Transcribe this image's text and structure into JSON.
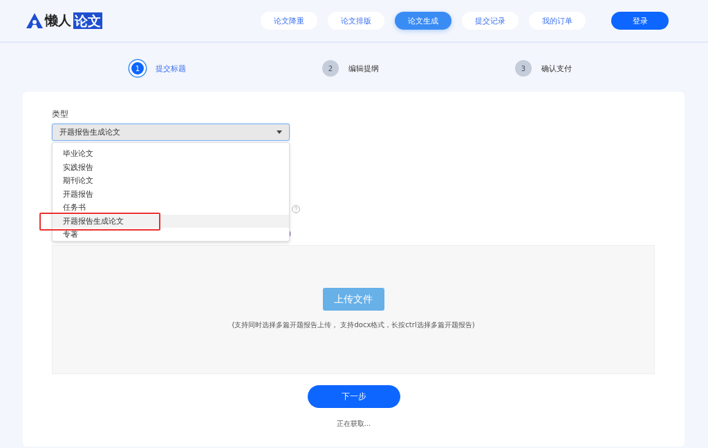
{
  "header": {
    "logo": {
      "text": "懒人",
      "badge": "论文"
    },
    "nav": [
      {
        "label": "论文降重",
        "selected": false
      },
      {
        "label": "论文排版",
        "selected": false
      },
      {
        "label": "论文生成",
        "selected": true
      },
      {
        "label": "提交记录",
        "selected": false
      },
      {
        "label": "我的订单",
        "selected": false
      }
    ],
    "login": "登录"
  },
  "steps": [
    {
      "number": "1",
      "label": "提交标题",
      "selected": true
    },
    {
      "number": "2",
      "label": "编辑提纲",
      "selected": false
    },
    {
      "number": "3",
      "label": "确认支付",
      "selected": false
    }
  ],
  "form": {
    "type_label": "类型",
    "select": {
      "value": "开题报告生成论文",
      "expanded": true
    },
    "options": [
      {
        "label": "毕业论文",
        "hovered": false,
        "annotated": false
      },
      {
        "label": "实践报告",
        "hovered": false,
        "annotated": false
      },
      {
        "label": "期刊论文",
        "hovered": false,
        "annotated": false
      },
      {
        "label": "开题报告",
        "hovered": false,
        "annotated": false
      },
      {
        "label": "任务书",
        "hovered": false,
        "annotated": false
      },
      {
        "label": "开题报告生成论文",
        "hovered": true,
        "annotated": true
      },
      {
        "label": "专著",
        "hovered": false,
        "annotated": false
      }
    ],
    "hidden_fragment": ")",
    "upload": {
      "button": "上传文件",
      "hint": "(支持同时选择多篇开题报告上传， 支持docx格式，长按ctrl选择多篇开题报告)"
    },
    "next": "下一步",
    "status": "正在获取..."
  }
}
